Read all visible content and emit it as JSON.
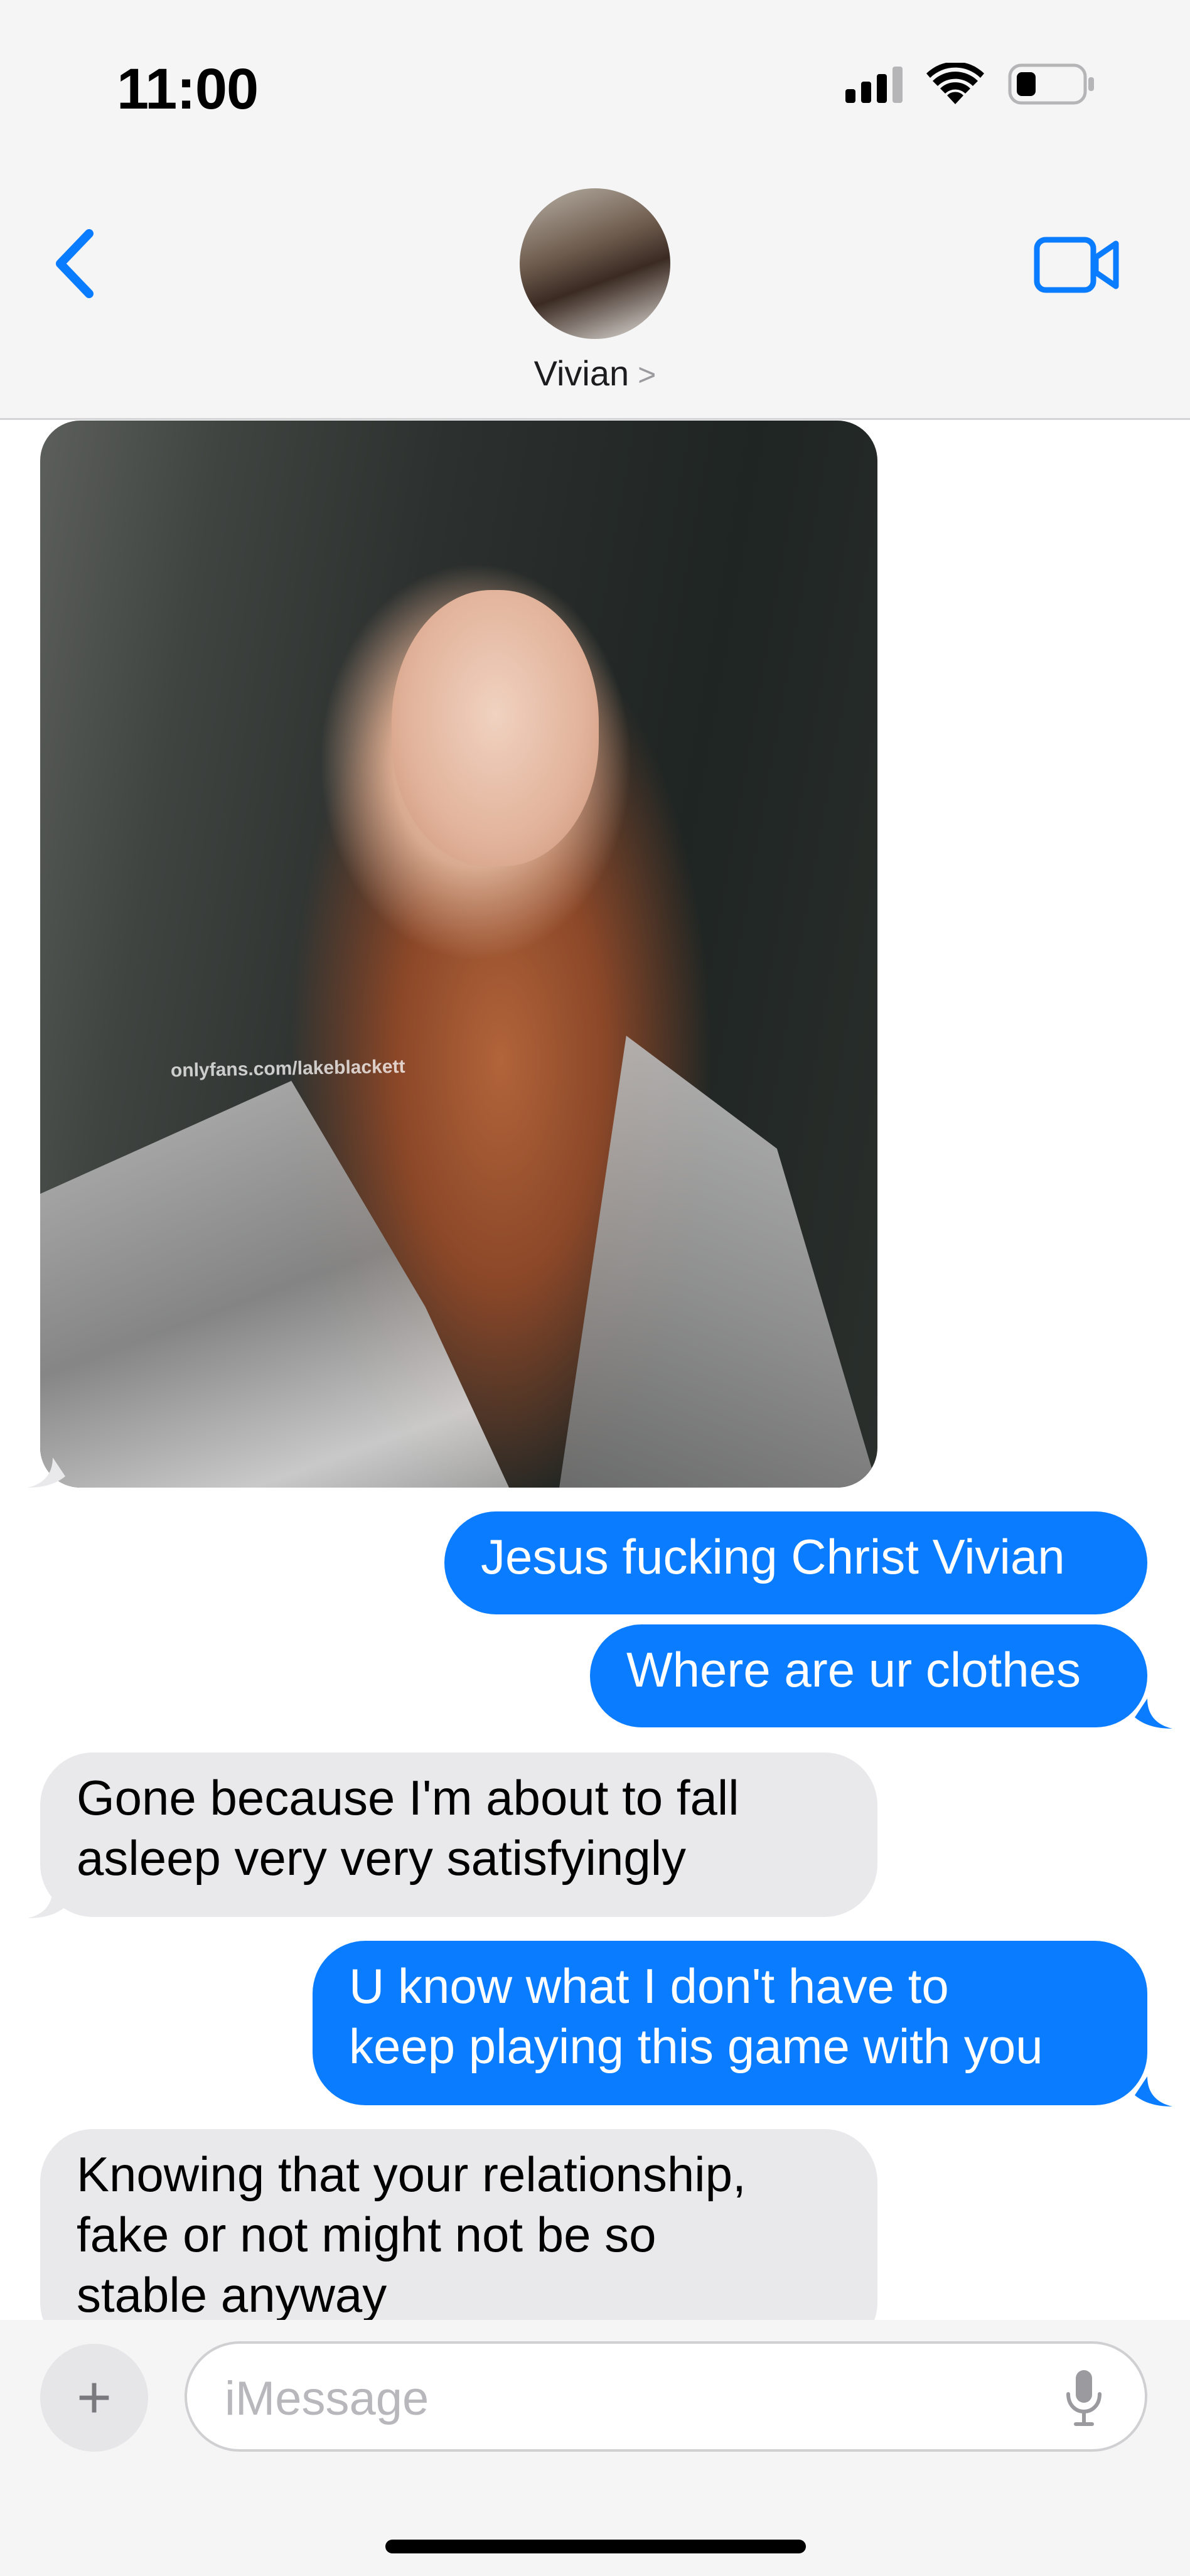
{
  "status_bar": {
    "time": "11:00",
    "icons": [
      "cellular-signal-icon",
      "wifi-icon",
      "battery-icon"
    ]
  },
  "header": {
    "back_icon": "chevron-left-icon",
    "contact_name": "Vivian",
    "contact_chevron": ">",
    "video_icon": "video-camera-icon"
  },
  "conversation": {
    "photo": {
      "description_icon": "photo-attachment",
      "watermark": "onlyfans.com/lakeblackett"
    },
    "messages": [
      {
        "from": "me",
        "text": "Jesus fucking Christ Vivian"
      },
      {
        "from": "me",
        "text": "Where are ur clothes"
      },
      {
        "from": "them",
        "text": "Gone because I'm about to fall\nasleep very very satisfyingly"
      },
      {
        "from": "me",
        "text": "U know what I don't have to\nkeep playing this game with you"
      },
      {
        "from": "them",
        "text": "Knowing that your relationship,\nfake or not might not be so\nstable anyway"
      }
    ]
  },
  "input_bar": {
    "plus_label": "+",
    "placeholder": "iMessage",
    "mic_icon": "microphone-icon"
  },
  "colors": {
    "sent_bubble": "#0a7cff",
    "received_bubble": "#e9e9eb",
    "accent": "#0a7cff",
    "bar_background": "#f5f5f5"
  }
}
